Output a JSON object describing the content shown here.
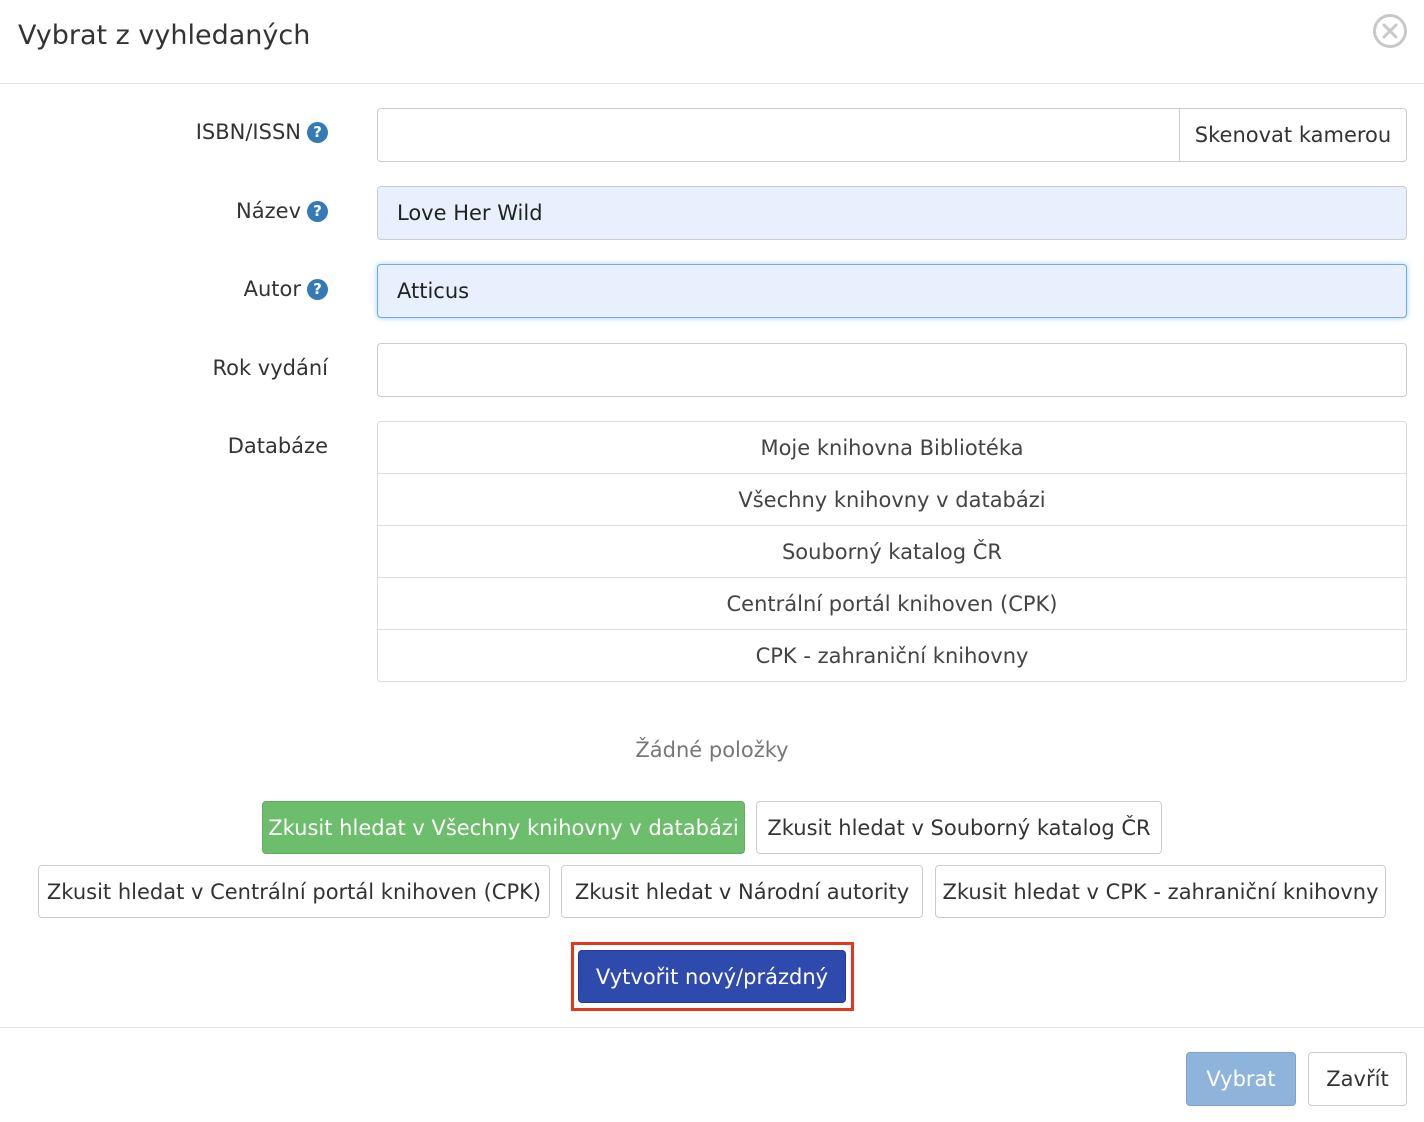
{
  "dialog": {
    "title": "Vybrat z vyhledaných"
  },
  "form": {
    "isbn": {
      "label": "ISBN/ISSN",
      "value": "",
      "scan_label": "Skenovat kamerou"
    },
    "title": {
      "label": "Název",
      "value": "Love Her Wild"
    },
    "author": {
      "label": "Autor",
      "value": "Atticus"
    },
    "year": {
      "label": "Rok vydání",
      "value": ""
    },
    "database": {
      "label": "Databáze",
      "items": [
        "Moje knihovna Bibliotéka",
        "Všechny knihovny v databázi",
        "Souborný katalog ČR",
        "Centrální portál knihoven (CPK)",
        "CPK - zahraniční knihovny"
      ]
    }
  },
  "results": {
    "empty_text": "Žádné položky",
    "try_buttons": [
      "Zkusit hledat v Všechny knihovny v databázi",
      "Zkusit hledat v Souborný katalog ČR",
      "Zkusit hledat v Centrální portál knihoven (CPK)",
      "Zkusit hledat v Národní autority",
      "Zkusit hledat v CPK - zahraniční knihovny"
    ],
    "create_label": "Vytvořit nový/prázdný"
  },
  "footer": {
    "select_label": "Vybrat",
    "close_label": "Zavřít"
  },
  "colors": {
    "success": "#6cbd6c",
    "primary": "#2f4aad",
    "highlight": "#e03a1e",
    "select_disabled": "#8fb4dc",
    "help_icon": "#337ab7"
  }
}
